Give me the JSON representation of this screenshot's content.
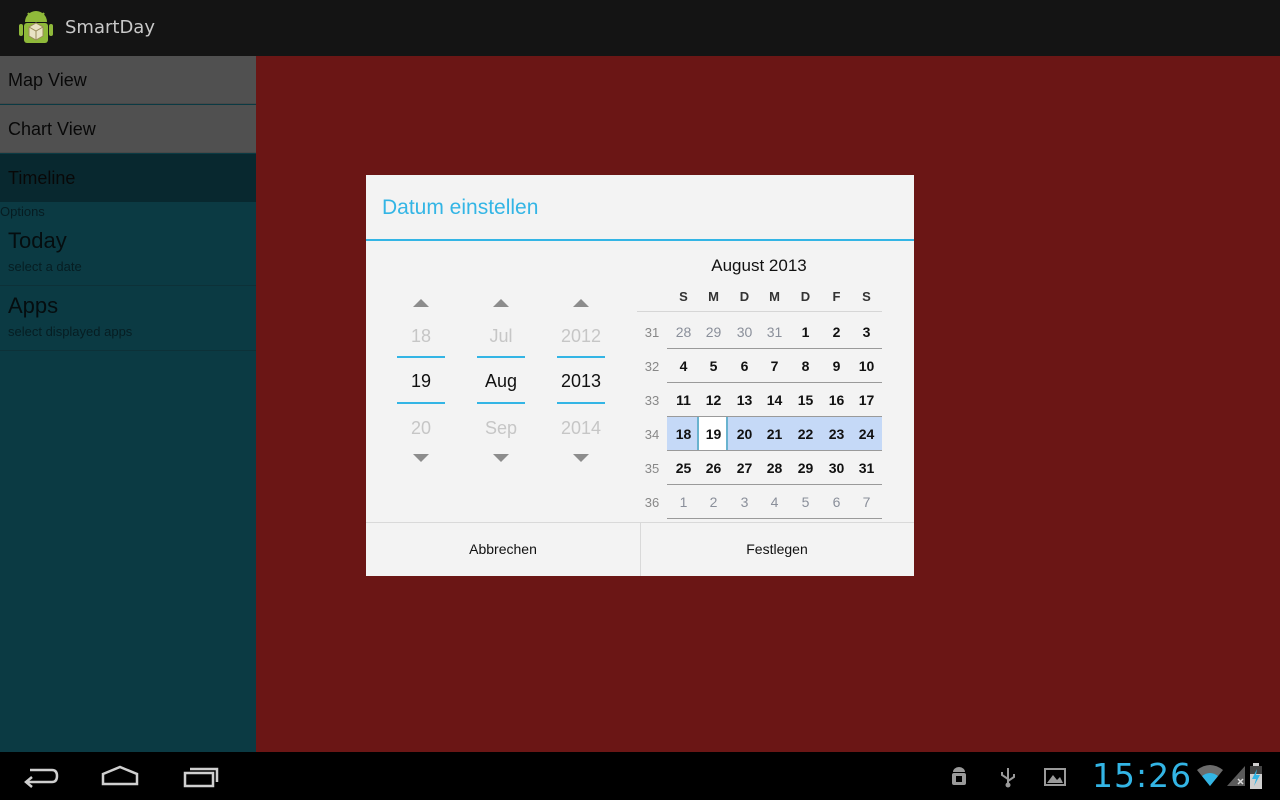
{
  "app": {
    "title": "SmartDay"
  },
  "sidebar": {
    "nav_items": [
      {
        "label": "Map View"
      },
      {
        "label": "Chart View"
      },
      {
        "label": "Timeline"
      }
    ],
    "options_label": "Options",
    "options": [
      {
        "title": "Today",
        "subtitle": "select a date"
      },
      {
        "title": "Apps",
        "subtitle": "select displayed apps"
      }
    ]
  },
  "dialog": {
    "title": "Datum einstellen",
    "day_picker": {
      "prev": "18",
      "current": "19",
      "next": "20"
    },
    "month_picker": {
      "prev": "Jul",
      "current": "Aug",
      "next": "Sep"
    },
    "year_picker": {
      "prev": "2012",
      "current": "2013",
      "next": "2014"
    },
    "calendar": {
      "month_label": "August 2013",
      "weekdays": [
        "S",
        "M",
        "D",
        "M",
        "D",
        "F",
        "S"
      ],
      "weeks": [
        {
          "num": "31",
          "days": [
            "28",
            "29",
            "30",
            "31",
            "1",
            "2",
            "3"
          ]
        },
        {
          "num": "32",
          "days": [
            "4",
            "5",
            "6",
            "7",
            "8",
            "9",
            "10"
          ]
        },
        {
          "num": "33",
          "days": [
            "11",
            "12",
            "13",
            "14",
            "15",
            "16",
            "17"
          ]
        },
        {
          "num": "34",
          "days": [
            "18",
            "19",
            "20",
            "21",
            "22",
            "23",
            "24"
          ]
        },
        {
          "num": "35",
          "days": [
            "25",
            "26",
            "27",
            "28",
            "29",
            "30",
            "31"
          ]
        },
        {
          "num": "36",
          "days": [
            "1",
            "2",
            "3",
            "4",
            "5",
            "6",
            "7"
          ]
        }
      ],
      "selected_day": "19"
    },
    "cancel_label": "Abbrechen",
    "confirm_label": "Festlegen"
  },
  "navbar": {
    "icons": [
      "back-icon",
      "home-icon",
      "recent-apps-icon"
    ]
  },
  "status": {
    "time": "15:26",
    "icons": [
      "android-debug-icon",
      "usb-icon",
      "gallery-icon",
      "wifi-icon",
      "signal-icon",
      "battery-charging-icon"
    ]
  },
  "colors": {
    "accent": "#33b5e5",
    "sidebar": "#166f80",
    "sidebar_selected": "#114e5b",
    "main_background": "#ce2b29",
    "week_highlight": "#c5d9f7"
  }
}
